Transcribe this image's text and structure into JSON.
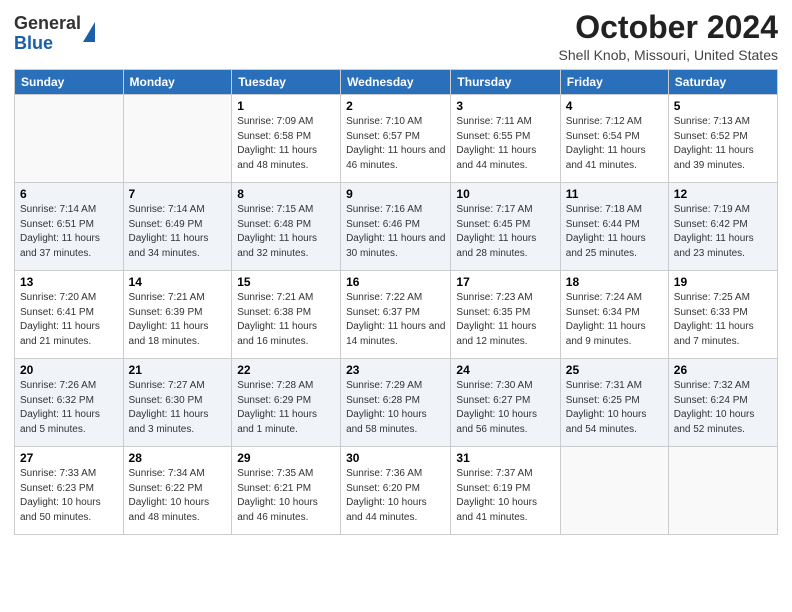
{
  "header": {
    "logo_general": "General",
    "logo_blue": "Blue",
    "month_title": "October 2024",
    "location": "Shell Knob, Missouri, United States"
  },
  "days_of_week": [
    "Sunday",
    "Monday",
    "Tuesday",
    "Wednesday",
    "Thursday",
    "Friday",
    "Saturday"
  ],
  "weeks": [
    [
      {
        "num": "",
        "sunrise": "",
        "sunset": "",
        "daylight": ""
      },
      {
        "num": "",
        "sunrise": "",
        "sunset": "",
        "daylight": ""
      },
      {
        "num": "1",
        "sunrise": "Sunrise: 7:09 AM",
        "sunset": "Sunset: 6:58 PM",
        "daylight": "Daylight: 11 hours and 48 minutes."
      },
      {
        "num": "2",
        "sunrise": "Sunrise: 7:10 AM",
        "sunset": "Sunset: 6:57 PM",
        "daylight": "Daylight: 11 hours and 46 minutes."
      },
      {
        "num": "3",
        "sunrise": "Sunrise: 7:11 AM",
        "sunset": "Sunset: 6:55 PM",
        "daylight": "Daylight: 11 hours and 44 minutes."
      },
      {
        "num": "4",
        "sunrise": "Sunrise: 7:12 AM",
        "sunset": "Sunset: 6:54 PM",
        "daylight": "Daylight: 11 hours and 41 minutes."
      },
      {
        "num": "5",
        "sunrise": "Sunrise: 7:13 AM",
        "sunset": "Sunset: 6:52 PM",
        "daylight": "Daylight: 11 hours and 39 minutes."
      }
    ],
    [
      {
        "num": "6",
        "sunrise": "Sunrise: 7:14 AM",
        "sunset": "Sunset: 6:51 PM",
        "daylight": "Daylight: 11 hours and 37 minutes."
      },
      {
        "num": "7",
        "sunrise": "Sunrise: 7:14 AM",
        "sunset": "Sunset: 6:49 PM",
        "daylight": "Daylight: 11 hours and 34 minutes."
      },
      {
        "num": "8",
        "sunrise": "Sunrise: 7:15 AM",
        "sunset": "Sunset: 6:48 PM",
        "daylight": "Daylight: 11 hours and 32 minutes."
      },
      {
        "num": "9",
        "sunrise": "Sunrise: 7:16 AM",
        "sunset": "Sunset: 6:46 PM",
        "daylight": "Daylight: 11 hours and 30 minutes."
      },
      {
        "num": "10",
        "sunrise": "Sunrise: 7:17 AM",
        "sunset": "Sunset: 6:45 PM",
        "daylight": "Daylight: 11 hours and 28 minutes."
      },
      {
        "num": "11",
        "sunrise": "Sunrise: 7:18 AM",
        "sunset": "Sunset: 6:44 PM",
        "daylight": "Daylight: 11 hours and 25 minutes."
      },
      {
        "num": "12",
        "sunrise": "Sunrise: 7:19 AM",
        "sunset": "Sunset: 6:42 PM",
        "daylight": "Daylight: 11 hours and 23 minutes."
      }
    ],
    [
      {
        "num": "13",
        "sunrise": "Sunrise: 7:20 AM",
        "sunset": "Sunset: 6:41 PM",
        "daylight": "Daylight: 11 hours and 21 minutes."
      },
      {
        "num": "14",
        "sunrise": "Sunrise: 7:21 AM",
        "sunset": "Sunset: 6:39 PM",
        "daylight": "Daylight: 11 hours and 18 minutes."
      },
      {
        "num": "15",
        "sunrise": "Sunrise: 7:21 AM",
        "sunset": "Sunset: 6:38 PM",
        "daylight": "Daylight: 11 hours and 16 minutes."
      },
      {
        "num": "16",
        "sunrise": "Sunrise: 7:22 AM",
        "sunset": "Sunset: 6:37 PM",
        "daylight": "Daylight: 11 hours and 14 minutes."
      },
      {
        "num": "17",
        "sunrise": "Sunrise: 7:23 AM",
        "sunset": "Sunset: 6:35 PM",
        "daylight": "Daylight: 11 hours and 12 minutes."
      },
      {
        "num": "18",
        "sunrise": "Sunrise: 7:24 AM",
        "sunset": "Sunset: 6:34 PM",
        "daylight": "Daylight: 11 hours and 9 minutes."
      },
      {
        "num": "19",
        "sunrise": "Sunrise: 7:25 AM",
        "sunset": "Sunset: 6:33 PM",
        "daylight": "Daylight: 11 hours and 7 minutes."
      }
    ],
    [
      {
        "num": "20",
        "sunrise": "Sunrise: 7:26 AM",
        "sunset": "Sunset: 6:32 PM",
        "daylight": "Daylight: 11 hours and 5 minutes."
      },
      {
        "num": "21",
        "sunrise": "Sunrise: 7:27 AM",
        "sunset": "Sunset: 6:30 PM",
        "daylight": "Daylight: 11 hours and 3 minutes."
      },
      {
        "num": "22",
        "sunrise": "Sunrise: 7:28 AM",
        "sunset": "Sunset: 6:29 PM",
        "daylight": "Daylight: 11 hours and 1 minute."
      },
      {
        "num": "23",
        "sunrise": "Sunrise: 7:29 AM",
        "sunset": "Sunset: 6:28 PM",
        "daylight": "Daylight: 10 hours and 58 minutes."
      },
      {
        "num": "24",
        "sunrise": "Sunrise: 7:30 AM",
        "sunset": "Sunset: 6:27 PM",
        "daylight": "Daylight: 10 hours and 56 minutes."
      },
      {
        "num": "25",
        "sunrise": "Sunrise: 7:31 AM",
        "sunset": "Sunset: 6:25 PM",
        "daylight": "Daylight: 10 hours and 54 minutes."
      },
      {
        "num": "26",
        "sunrise": "Sunrise: 7:32 AM",
        "sunset": "Sunset: 6:24 PM",
        "daylight": "Daylight: 10 hours and 52 minutes."
      }
    ],
    [
      {
        "num": "27",
        "sunrise": "Sunrise: 7:33 AM",
        "sunset": "Sunset: 6:23 PM",
        "daylight": "Daylight: 10 hours and 50 minutes."
      },
      {
        "num": "28",
        "sunrise": "Sunrise: 7:34 AM",
        "sunset": "Sunset: 6:22 PM",
        "daylight": "Daylight: 10 hours and 48 minutes."
      },
      {
        "num": "29",
        "sunrise": "Sunrise: 7:35 AM",
        "sunset": "Sunset: 6:21 PM",
        "daylight": "Daylight: 10 hours and 46 minutes."
      },
      {
        "num": "30",
        "sunrise": "Sunrise: 7:36 AM",
        "sunset": "Sunset: 6:20 PM",
        "daylight": "Daylight: 10 hours and 44 minutes."
      },
      {
        "num": "31",
        "sunrise": "Sunrise: 7:37 AM",
        "sunset": "Sunset: 6:19 PM",
        "daylight": "Daylight: 10 hours and 41 minutes."
      },
      {
        "num": "",
        "sunrise": "",
        "sunset": "",
        "daylight": ""
      },
      {
        "num": "",
        "sunrise": "",
        "sunset": "",
        "daylight": ""
      }
    ]
  ]
}
